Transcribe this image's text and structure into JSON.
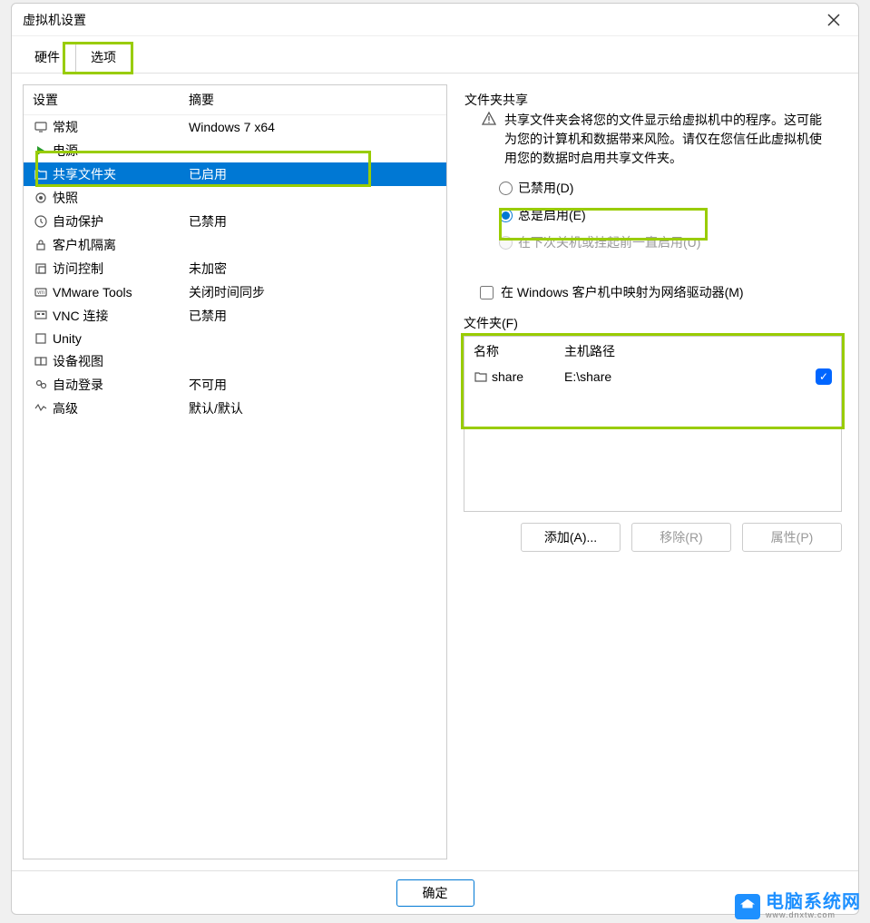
{
  "window": {
    "title": "虚拟机设置"
  },
  "tabs": {
    "hardware": "硬件",
    "options": "选项"
  },
  "left": {
    "header": {
      "setting": "设置",
      "summary": "摘要"
    },
    "items": [
      {
        "label": "常规",
        "summary": "Windows 7 x64",
        "icon": "monitor"
      },
      {
        "label": "电源",
        "summary": "",
        "icon": "power"
      },
      {
        "label": "共享文件夹",
        "summary": "已启用",
        "icon": "folder-share",
        "selected": true
      },
      {
        "label": "快照",
        "summary": "",
        "icon": "snapshot"
      },
      {
        "label": "自动保护",
        "summary": "已禁用",
        "icon": "clock"
      },
      {
        "label": "客户机隔离",
        "summary": "",
        "icon": "lock"
      },
      {
        "label": "访问控制",
        "summary": "未加密",
        "icon": "access"
      },
      {
        "label": "VMware Tools",
        "summary": "关闭时间同步",
        "icon": "vm"
      },
      {
        "label": "VNC 连接",
        "summary": "已禁用",
        "icon": "vnc"
      },
      {
        "label": "Unity",
        "summary": "",
        "icon": "unity"
      },
      {
        "label": "设备视图",
        "summary": "",
        "icon": "device"
      },
      {
        "label": "自动登录",
        "summary": "不可用",
        "icon": "autologin"
      },
      {
        "label": "高级",
        "summary": "默认/默认",
        "icon": "advanced"
      }
    ]
  },
  "right": {
    "sharing": {
      "title": "文件夹共享",
      "warning": "共享文件夹会将您的文件显示给虚拟机中的程序。这可能为您的计算机和数据带来风险。请仅在您信任此虚拟机使用您的数据时启用共享文件夹。",
      "radio_disabled": "已禁用(D)",
      "radio_always": "总是启用(E)",
      "radio_until": "在下次关机或挂起前一直启用(U)",
      "map_checkbox": "在 Windows 客户机中映射为网络驱动器(M)"
    },
    "folders": {
      "title": "文件夹(F)",
      "col_name": "名称",
      "col_path": "主机路径",
      "rows": [
        {
          "name": "share",
          "path": "E:\\share",
          "enabled": true
        }
      ],
      "btn_add": "添加(A)...",
      "btn_remove": "移除(R)",
      "btn_props": "属性(P)"
    }
  },
  "footer": {
    "ok": "确定"
  },
  "watermark": {
    "main": "电脑系统网",
    "sub": "www.dnxtw.com"
  }
}
